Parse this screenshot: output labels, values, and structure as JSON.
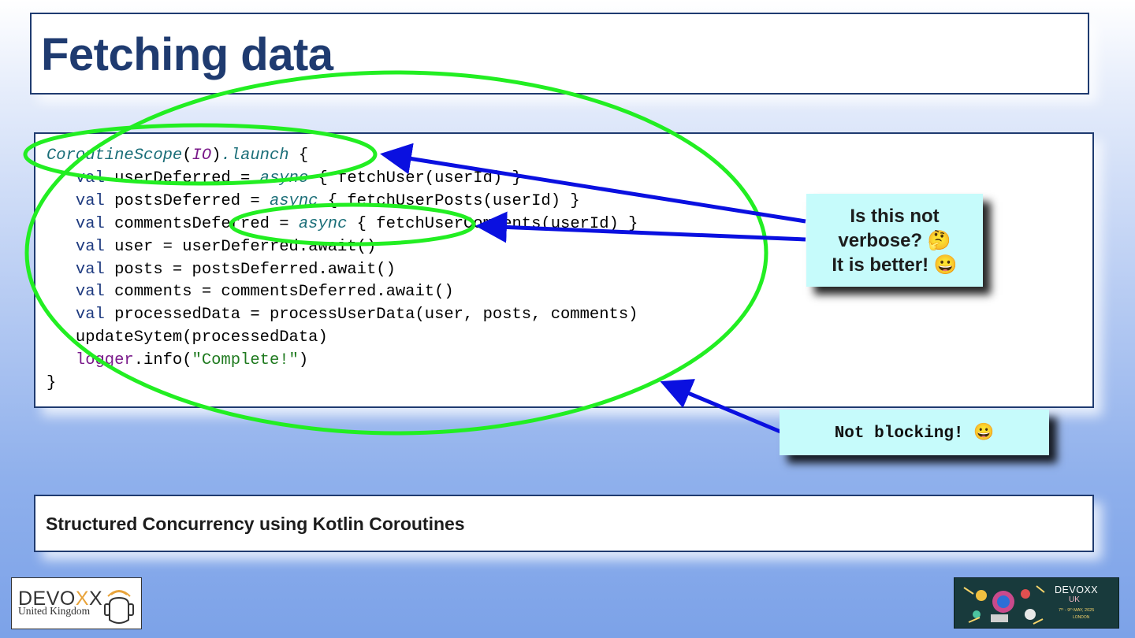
{
  "slide": {
    "title": "Fetching data",
    "footer_text": "Structured Concurrency using Kotlin Coroutines"
  },
  "code": {
    "line1": {
      "scope": "CoroutineScope",
      "open": "(",
      "io": "IO",
      "close": ")",
      "launch": ".launch",
      "brace": " {"
    },
    "line2": {
      "indent": "   ",
      "kw": "val",
      "rest_a": " userDeferred = ",
      "async": "async",
      "rest_b": " { fetchUser(userId) }"
    },
    "line3": {
      "indent": "   ",
      "kw": "val",
      "rest_a": " postsDeferred = ",
      "async": "async",
      "rest_b": " { fetchUserPosts(userId) }"
    },
    "line4": {
      "indent": "   ",
      "kw": "val",
      "rest_a": " commentsDeferred = ",
      "async": "async",
      "rest_b": " { fetchUserComments(userId) }"
    },
    "line5": {
      "indent": "   ",
      "kw": "val",
      "rest": " user = userDeferred.await()"
    },
    "line6": {
      "indent": "   ",
      "kw": "val",
      "rest": " posts = postsDeferred.await()"
    },
    "line7": {
      "indent": "   ",
      "kw": "val",
      "rest": " comments = commentsDeferred.await()"
    },
    "line8": {
      "indent": "   ",
      "kw": "val",
      "rest": " processedData = processUserData(user, posts, comments)"
    },
    "line9": {
      "indent": "   ",
      "text": "updateSytem(processedData)"
    },
    "line10": {
      "indent": "   ",
      "logger": "logger",
      "mid": ".info(",
      "str": "\"Complete!\"",
      "end": ")"
    },
    "line11": {
      "text": "}"
    }
  },
  "callouts": {
    "verbose_line1": "Is this not",
    "verbose_line2": "verbose? 🤔",
    "verbose_line3": "It is better! 😀",
    "blocking": "Not blocking! 😀"
  },
  "logos": {
    "devoxx_left_line1_a": "DEVO",
    "devoxx_left_line1_x": "X",
    "devoxx_left_line1_b": "X",
    "devoxx_left_line2": "United Kingdom",
    "devoxx_uk_line1": "DEVOXX",
    "devoxx_uk_line2": "UK",
    "devoxx_uk_line3": "7ᵗʰ - 9ᵗʰ MAY, 2025",
    "devoxx_uk_line4": "LONDON"
  },
  "colors": {
    "title": "#1f3b70",
    "keyword": "#1f3b80",
    "italic_teal": "#1a6e78",
    "purple": "#7a1a8a",
    "string": "#1f7a1f",
    "callout_bg": "#c6fbfb",
    "highlight_ellipse": "#22ee22",
    "arrow": "#0a10e0"
  }
}
